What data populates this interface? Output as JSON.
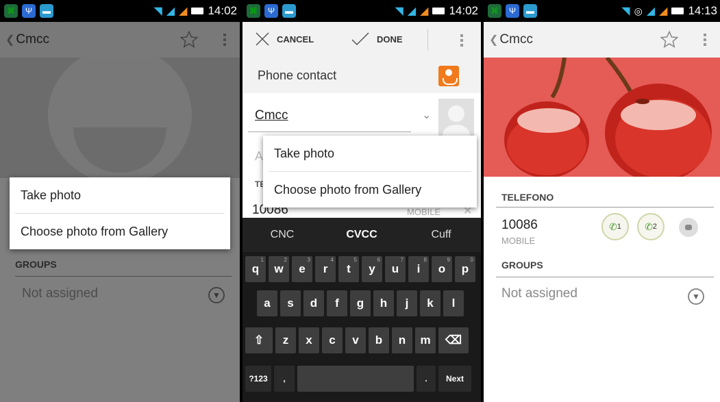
{
  "screen1": {
    "status": {
      "time": "14:02"
    },
    "header": {
      "back_label": "Cmcc"
    },
    "popup": {
      "take_photo": "Take photo",
      "choose_gallery": "Choose photo from Gallery"
    },
    "groups": {
      "header": "GROUPS",
      "value": "Not assigned"
    }
  },
  "screen2": {
    "status": {
      "time": "14:02"
    },
    "toolbar": {
      "cancel_label": "CANCEL",
      "done_label": "DONE"
    },
    "account": {
      "label": "Phone contact"
    },
    "name": {
      "value": "Cmcc"
    },
    "behind": {
      "a": "A",
      "t": "TE"
    },
    "phone": {
      "number": "10086",
      "type": "MOBILE"
    },
    "popup": {
      "take_photo": "Take photo",
      "choose_gallery": "Choose photo from Gallery"
    },
    "keyboard": {
      "suggestions": [
        "CNC",
        "CVCC",
        "Cuff"
      ],
      "row1": [
        {
          "k": "q",
          "n": "1"
        },
        {
          "k": "w",
          "n": "2"
        },
        {
          "k": "e",
          "n": "3"
        },
        {
          "k": "r",
          "n": "4"
        },
        {
          "k": "t",
          "n": "5"
        },
        {
          "k": "y",
          "n": "6"
        },
        {
          "k": "u",
          "n": "7"
        },
        {
          "k": "i",
          "n": "8"
        },
        {
          "k": "o",
          "n": "9"
        },
        {
          "k": "p",
          "n": "0"
        }
      ],
      "row2": [
        "a",
        "s",
        "d",
        "f",
        "g",
        "h",
        "j",
        "k",
        "l"
      ],
      "row3": [
        "z",
        "x",
        "c",
        "v",
        "b",
        "n",
        "m"
      ],
      "symbols_label": "?123",
      "comma_label": ",",
      "period_label": ".",
      "next_label": "Next"
    }
  },
  "screen3": {
    "status": {
      "time": "14:13"
    },
    "header": {
      "back_label": "Cmcc"
    },
    "telefono": {
      "header": "TELEFONO",
      "number": "10086",
      "type": "MOBILE"
    },
    "call_buttons": [
      "1",
      "2"
    ],
    "groups": {
      "header": "GROUPS",
      "value": "Not assigned"
    }
  },
  "colors": {
    "accent_blue": "#33b5e5",
    "signal_orange": "#f28c1e",
    "cherry_red": "#e55b55",
    "call_green": "#4a9a2a"
  }
}
